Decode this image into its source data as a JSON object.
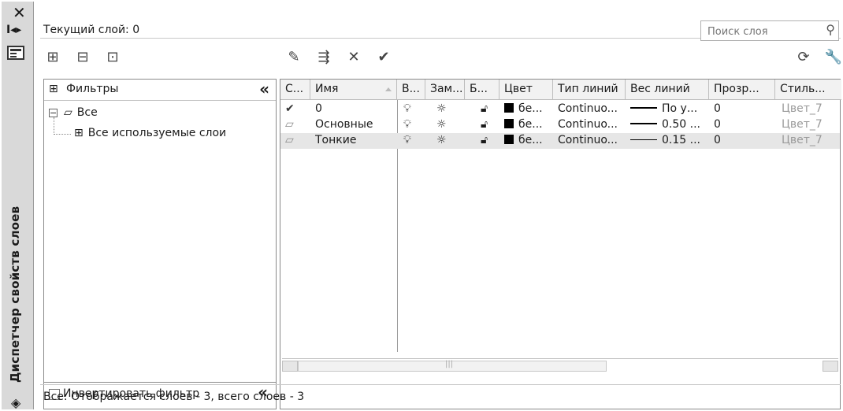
{
  "palette_title": "Диспетчер свойств слоев",
  "current_layer": "Текущий слой: 0",
  "search": {
    "placeholder": "Поиск слоя"
  },
  "filters": {
    "header": "Фильтры",
    "tree": [
      {
        "label": "Все",
        "expanded": true
      },
      {
        "label": "Все используемые слои"
      }
    ],
    "invert_label": "Инвертировать фильтр",
    "invert_checked": false
  },
  "columns": [
    "С...",
    "Имя",
    "В...",
    "Зам...",
    "Б...",
    "Цвет",
    "Тип линий",
    "Вес линий",
    "Прозр...",
    "Стиль..."
  ],
  "layers": [
    {
      "current": true,
      "name": "0",
      "color": "бе...",
      "linetype": "Continuo...",
      "lineweight": "По у...",
      "transparency": "0",
      "plotstyle": "Цвет_7"
    },
    {
      "current": false,
      "name": "Основные",
      "color": "бе...",
      "linetype": "Continuo...",
      "lineweight": "0.50 ...",
      "transparency": "0",
      "plotstyle": "Цвет_7"
    },
    {
      "current": false,
      "name": "Тонкие",
      "color": "бе...",
      "linetype": "Continuo...",
      "lineweight": "0.15 ...",
      "transparency": "0",
      "plotstyle": "Цвет_7"
    }
  ],
  "status": "Все: Отображается слоев - 3, всего слоев - 3",
  "colors": {
    "swatch": "#000000",
    "selected_row": "#e6e6e6"
  }
}
